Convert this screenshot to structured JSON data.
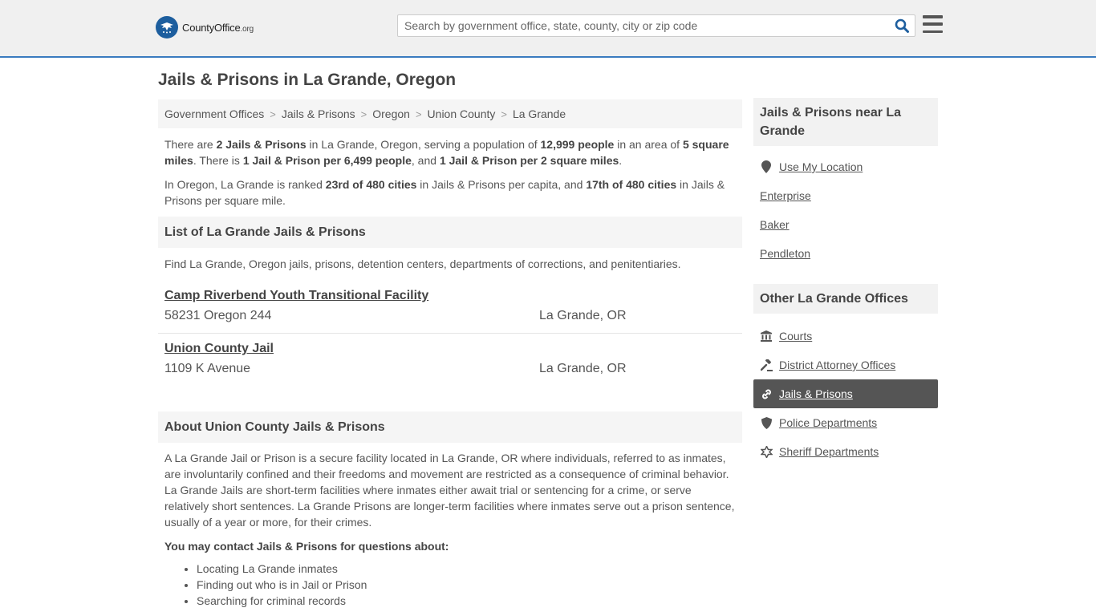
{
  "header": {
    "logo_text_main": "CountyOffice",
    "logo_text_tld": ".org",
    "search_placeholder": "Search by government office, state, county, city or zip code"
  },
  "page_title": "Jails & Prisons in La Grande, Oregon",
  "breadcrumb": [
    "Government Offices",
    "Jails & Prisons",
    "Oregon",
    "Union County",
    "La Grande"
  ],
  "intro": {
    "p1": [
      {
        "t": "There are ",
        "b": false
      },
      {
        "t": "2 Jails & Prisons",
        "b": true
      },
      {
        "t": " in La Grande, Oregon, serving a population of ",
        "b": false
      },
      {
        "t": "12,999 people",
        "b": true
      },
      {
        "t": " in an area of ",
        "b": false
      },
      {
        "t": "5 square miles",
        "b": true
      },
      {
        "t": ". There is ",
        "b": false
      },
      {
        "t": "1 Jail & Prison per 6,499 people",
        "b": true
      },
      {
        "t": ", and ",
        "b": false
      },
      {
        "t": "1 Jail & Prison per 2 square miles",
        "b": true
      },
      {
        "t": ".",
        "b": false
      }
    ],
    "p2": [
      {
        "t": "In Oregon, La Grande is ranked ",
        "b": false
      },
      {
        "t": "23rd of 480 cities",
        "b": true
      },
      {
        "t": " in Jails & Prisons per capita, and ",
        "b": false
      },
      {
        "t": "17th of 480 cities",
        "b": true
      },
      {
        "t": " in Jails & Prisons per square mile.",
        "b": false
      }
    ]
  },
  "list_section": {
    "title": "List of La Grande Jails & Prisons",
    "description": "Find La Grande, Oregon jails, prisons, detention centers, departments of corrections, and penitentiaries.",
    "facilities": [
      {
        "name": "Camp Riverbend Youth Transitional Facility",
        "address": "58231 Oregon 244",
        "city": "La Grande, OR"
      },
      {
        "name": "Union County Jail",
        "address": "1109 K Avenue",
        "city": "La Grande, OR"
      }
    ]
  },
  "about_section": {
    "title": "About Union County Jails & Prisons",
    "text": "A La Grande Jail or Prison is a secure facility located in La Grande, OR where individuals, referred to as inmates, are involuntarily confined and their freedoms and movement are restricted as a consequence of criminal behavior. La Grande Jails are short-term facilities where inmates either await trial or sentencing for a crime, or serve relatively short sentences. La Grande Prisons are longer-term facilities where inmates serve out a prison sentence, usually of a year or more, for their crimes.",
    "contact_heading": "You may contact Jails & Prisons for questions about:",
    "bullets": [
      "Locating La Grande inmates",
      "Finding out who is in Jail or Prison",
      "Searching for criminal records"
    ]
  },
  "sidebar": {
    "nearby_title": "Jails & Prisons near La Grande",
    "use_location": "Use My Location",
    "nearby": [
      "Enterprise",
      "Baker",
      "Pendleton"
    ],
    "other_title": "Other La Grande Offices",
    "offices": [
      {
        "label": "Courts",
        "icon": "courthouse-icon",
        "active": false
      },
      {
        "label": "District Attorney Offices",
        "icon": "gavel-icon",
        "active": false
      },
      {
        "label": "Jails & Prisons",
        "icon": "link-icon",
        "active": true
      },
      {
        "label": "Police Departments",
        "icon": "shield-icon",
        "active": false
      },
      {
        "label": "Sheriff Departments",
        "icon": "star-icon",
        "active": false
      }
    ]
  }
}
